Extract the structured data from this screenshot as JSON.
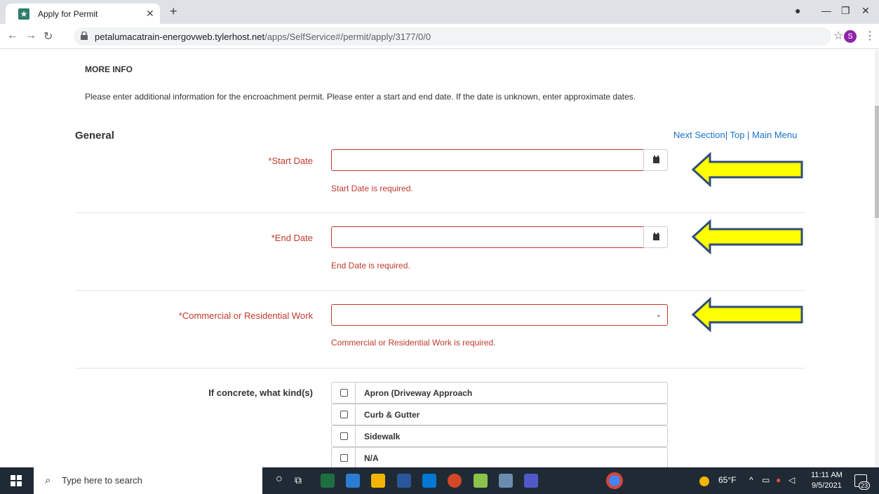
{
  "browser": {
    "tab_title": "Apply for Permit",
    "url_host": "petalumacatrain-energovweb.tylerhost.net",
    "url_path": "/apps/SelfService#/permit/apply/3177/0/0",
    "profile_initial": "S"
  },
  "page": {
    "heading": "MORE INFO",
    "description": "Please enter additional information for the encroachment permit. Please enter a start and end date. If the date is unknown, enter approximate dates.",
    "section_title": "General",
    "links": {
      "next": "Next Section",
      "top": "Top",
      "main": "Main Menu"
    },
    "fields": {
      "start_date": {
        "label": "*Start Date",
        "error": "Start Date is required."
      },
      "end_date": {
        "label": "*End Date",
        "error": "End Date is required."
      },
      "work_type": {
        "label": "*Commercial or Residential Work",
        "error": "Commercial or Residential Work is required."
      },
      "concrete": {
        "label": "If concrete, what kind(s)",
        "options": [
          "Apron (Driveway Approach",
          "Curb & Gutter",
          "Sidewalk",
          "N/A"
        ]
      }
    }
  },
  "taskbar": {
    "search_placeholder": "Type here to search",
    "weather": "65°F",
    "time": "11:11 AM",
    "date": "9/5/2021",
    "notifications": "23"
  },
  "colors": {
    "error": "#c0392b",
    "link": "#1a73c8",
    "arrow_fill": "#ffff00",
    "arrow_stroke": "#2f4d7a"
  }
}
